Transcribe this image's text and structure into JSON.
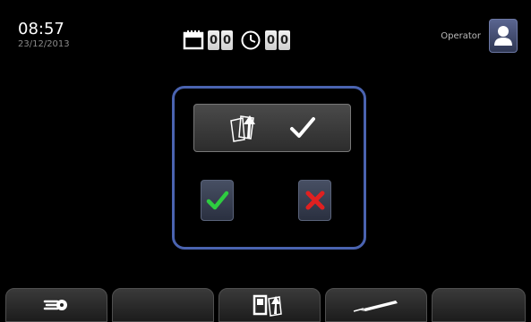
{
  "header": {
    "time": "08:57",
    "date": "23/12/2013",
    "operator_label": "Operator"
  },
  "counters": {
    "days_digits": [
      "0",
      "0"
    ],
    "hours_digits": [
      "0",
      "0"
    ]
  },
  "icons": {
    "calendar": "calendar-icon",
    "clock": "clock-icon",
    "user": "user-avatar-icon",
    "document_upload": "document-upload-icon",
    "checkmark": "checkmark-icon",
    "confirm": "green-check-icon",
    "cancel": "red-x-icon",
    "tab1": "air-flow-icon",
    "tab3": "sd-card-document-icon",
    "tab4": "pen-icon"
  },
  "colors": {
    "dialog_border": "#4a63b0",
    "confirm": "#2ecc40",
    "cancel": "#e02020"
  }
}
